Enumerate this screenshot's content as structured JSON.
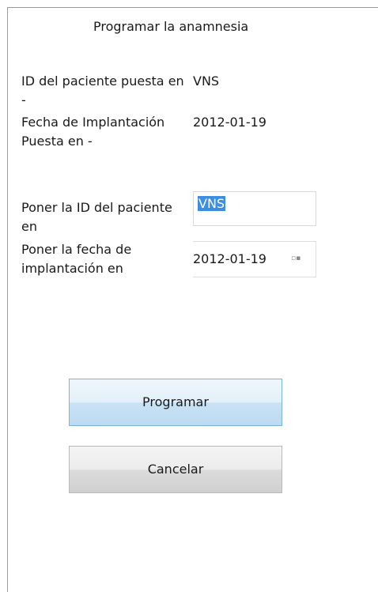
{
  "window": {
    "title": "Programar la anamnesia"
  },
  "current": {
    "patient_id_label": "ID del paciente puesta en  -",
    "patient_id_value": "VNS",
    "implant_date_label": "Fecha de Implantación Puesta en -",
    "implant_date_value": "2012-01-19"
  },
  "form": {
    "patient_id_label": "Poner la ID del paciente en",
    "patient_id_input": "VNS",
    "implant_date_label": "Poner la fecha de implantación en",
    "implant_date_input": "2012-01-19",
    "calendar_icon": "calendar-dropdown-icon",
    "calendar_glyph": "▫▪"
  },
  "buttons": {
    "program_label": "Programar",
    "cancel_label": "Cancelar"
  }
}
